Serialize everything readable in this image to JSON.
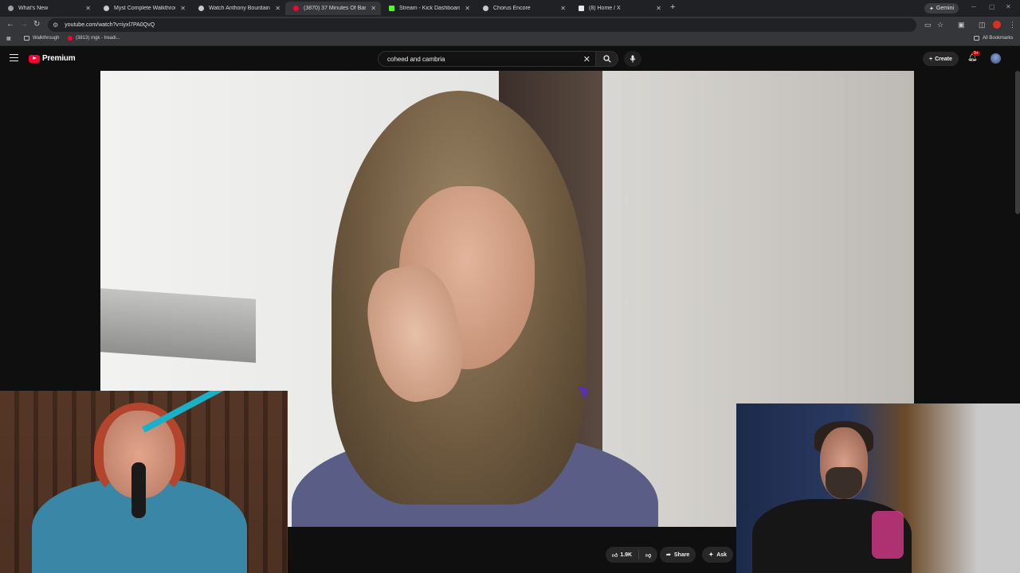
{
  "browser": {
    "tabs": [
      {
        "title": "What's New",
        "favicon_color": "#9aa0a6"
      },
      {
        "title": "Myst Complete Walkthrough -",
        "favicon_color": "#c9c9c9"
      },
      {
        "title": "Watch Anthony Bourdain's A Co",
        "favicon_color": "#c9c9c9"
      },
      {
        "title": "(3870) 37 Minutes Of Barta",
        "favicon_color": "#ff0033"
      },
      {
        "title": "Stream - Kick Dashboard",
        "favicon_color": "#53fc18"
      },
      {
        "title": "Chorus Encore",
        "favicon_color": "#c9c9c9"
      },
      {
        "title": "(8) Home / X",
        "favicon_color": "#e7e9ea"
      }
    ],
    "active_tab_index": 3,
    "gemini_label": "Gemini",
    "url": "youtube.com/watch?v=iyxl7PA0QvQ",
    "bookmarks": [
      {
        "label": "Walkthrough",
        "icon": "folder-icon"
      },
      {
        "label": "(3813) mgk - treadi...",
        "icon": "youtube-icon"
      }
    ],
    "all_bookmarks_label": "All Bookmarks"
  },
  "youtube": {
    "logo_text": "Premium",
    "search_value": "coheed and cambria",
    "create_label": "Create",
    "notification_badge": "9+",
    "like_count": "1.9K",
    "share_label": "Share",
    "ask_label": "Ask",
    "brand_color": "#ff0033"
  }
}
